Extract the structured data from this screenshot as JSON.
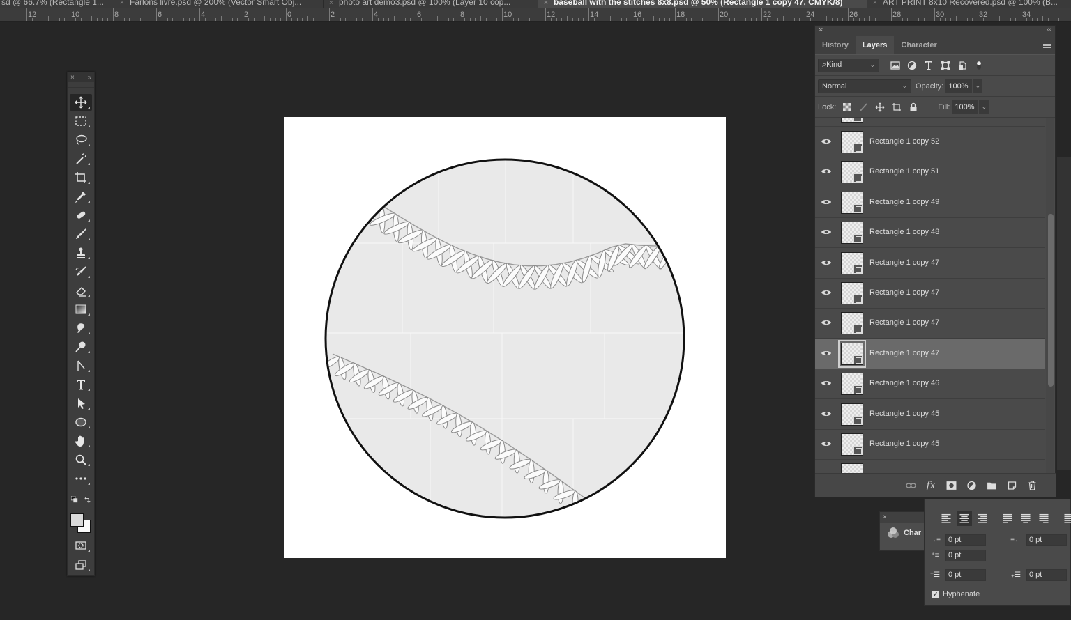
{
  "document_tabs": [
    {
      "label": "sd @ 66.7% (Rectangle 1...",
      "active": false
    },
    {
      "label": "Farlons livre.psd @ 200% (Vector Smart Obj...",
      "active": false
    },
    {
      "label": "photo art demo3.psd @ 100% (Layer 10 cop...",
      "active": false
    },
    {
      "label": "baseball with the stitches 8x8.psd @ 50% (Rectangle 1 copy 47, CMYK/8)",
      "active": true
    },
    {
      "label": "ART PRINT 8x10 Recovered.psd @ 100% (B...",
      "active": false
    }
  ],
  "ruler": {
    "labels": [
      "12",
      "10",
      "8",
      "6",
      "4",
      "2",
      "0",
      "2",
      "4",
      "6",
      "8",
      "10",
      "12",
      "14",
      "16",
      "18",
      "20",
      "22",
      "24",
      "26",
      "28",
      "30",
      "32",
      "34"
    ]
  },
  "toolbar": {
    "close": "×",
    "collapse": "»",
    "tools": [
      {
        "name": "move-tool",
        "active": true
      },
      {
        "name": "rectangular-marquee-tool"
      },
      {
        "name": "lasso-tool"
      },
      {
        "name": "magic-wand-tool"
      },
      {
        "name": "crop-tool"
      },
      {
        "name": "eyedropper-tool"
      },
      {
        "name": "healing-brush-tool"
      },
      {
        "name": "brush-tool"
      },
      {
        "name": "clone-stamp-tool"
      },
      {
        "name": "history-brush-tool"
      },
      {
        "name": "eraser-tool"
      },
      {
        "name": "gradient-tool"
      },
      {
        "name": "blur-tool"
      },
      {
        "name": "dodge-tool"
      },
      {
        "name": "pen-tool"
      },
      {
        "name": "type-tool"
      },
      {
        "name": "path-selection-tool"
      },
      {
        "name": "ellipse-tool"
      },
      {
        "name": "hand-tool"
      },
      {
        "name": "zoom-tool"
      },
      {
        "name": "more-tools"
      }
    ],
    "foreground_color": "#d9d9d9",
    "background_color": "#fafafa"
  },
  "layers_panel": {
    "close": "×",
    "collapse": "‹‹",
    "tabs": [
      {
        "label": "History",
        "active": false
      },
      {
        "label": "Layers",
        "active": true
      },
      {
        "label": "Character",
        "active": false
      }
    ],
    "filter": {
      "label": "Kind"
    },
    "blend_mode": "Normal",
    "opacity_label": "Opacity:",
    "opacity_value": "100%",
    "lock_label": "Lock:",
    "fill_label": "Fill:",
    "fill_value": "100%",
    "layers": [
      {
        "name": "Rectangle 1 copy 52",
        "visible": true,
        "selected": false
      },
      {
        "name": "Rectangle 1 copy 51",
        "visible": true,
        "selected": false
      },
      {
        "name": "Rectangle 1 copy 49",
        "visible": true,
        "selected": false
      },
      {
        "name": "Rectangle 1 copy 48",
        "visible": true,
        "selected": false
      },
      {
        "name": "Rectangle 1 copy 47",
        "visible": true,
        "selected": false
      },
      {
        "name": "Rectangle 1 copy 47",
        "visible": true,
        "selected": false
      },
      {
        "name": "Rectangle 1 copy 47",
        "visible": true,
        "selected": false
      },
      {
        "name": "Rectangle 1 copy 47",
        "visible": true,
        "selected": true
      },
      {
        "name": "Rectangle 1 copy 46",
        "visible": true,
        "selected": false
      },
      {
        "name": "Rectangle 1 copy 45",
        "visible": true,
        "selected": false
      },
      {
        "name": "Rectangle 1 copy 45",
        "visible": true,
        "selected": false
      }
    ],
    "footer_icons": [
      "link-layers-icon",
      "fx-icon",
      "add-mask-icon",
      "adjustment-layer-icon",
      "new-group-icon",
      "new-layer-icon",
      "delete-layer-icon"
    ],
    "fx_label": "fx"
  },
  "mini_panel": {
    "close": "×",
    "label": "Char"
  },
  "paragraph_panel": {
    "indent_left": "0 pt",
    "indent_right": "0 pt",
    "indent_first": "0 pt",
    "space_before": "0 pt",
    "space_after": "0 pt",
    "hyphenate_label": "Hyphenate",
    "hyphenate_checked": true,
    "alignments": [
      "align-left",
      "align-center",
      "align-right",
      "justify-left",
      "justify-center",
      "justify-right",
      "justify-all"
    ],
    "active_alignment": "align-center"
  }
}
